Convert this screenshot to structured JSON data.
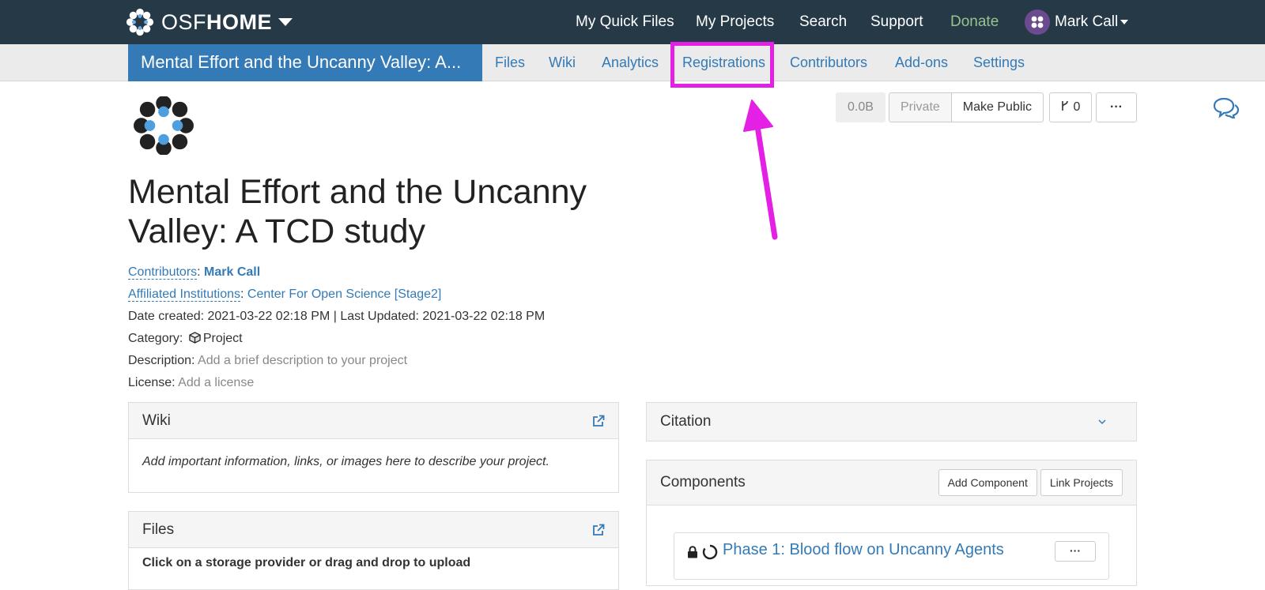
{
  "navbar": {
    "brand_light": "OSF",
    "brand_bold": "HOME",
    "links": [
      "My Quick Files",
      "My Projects",
      "Search",
      "Support",
      "Donate"
    ],
    "user_name": "Mark Call"
  },
  "subnav": {
    "project_title": "Mental Effort and the Uncanny Valley: A...",
    "tabs": [
      "Files",
      "Wiki",
      "Analytics",
      "Registrations",
      "Contributors",
      "Add-ons",
      "Settings"
    ],
    "highlighted_tab": "Registrations",
    "highlight_color": "#e520e5"
  },
  "toolbar": {
    "size": "0.0B",
    "private_label": "Private",
    "make_public_label": "Make Public",
    "fork_count": "0",
    "more_label": "···"
  },
  "project": {
    "title_line1": "Mental Effort and the Uncanny",
    "title_line2": "Valley: A TCD study",
    "contributors_label": "Contributors",
    "contributors_value": "Mark Call",
    "affiliated_label": "Affiliated Institutions",
    "affiliated_value": "Center For Open Science [Stage2]",
    "date_text": "Date created: 2021-03-22 02:18 PM | Last Updated: 2021-03-22 02:18 PM",
    "category_label": "Category:",
    "category_value": "Project",
    "description_label": "Description:",
    "description_value": "Add a brief description to your project",
    "license_label": "License:",
    "license_value": "Add a license"
  },
  "wiki_panel": {
    "title": "Wiki",
    "body": "Add important information, links, or images here to describe your project."
  },
  "files_panel": {
    "title": "Files",
    "body": "Click on a storage provider or drag and drop to upload"
  },
  "citation_panel": {
    "title": "Citation"
  },
  "components_panel": {
    "title": "Components",
    "add_component_label": "Add Component",
    "link_projects_label": "Link Projects",
    "item_title": "Phase 1: Blood flow on Uncanny Agents",
    "item_more_label": "···"
  },
  "colors": {
    "navbar_bg": "#263947",
    "link_blue": "#337ab7",
    "donate_green": "#99c28f",
    "annotation_magenta": "#e520e5"
  }
}
